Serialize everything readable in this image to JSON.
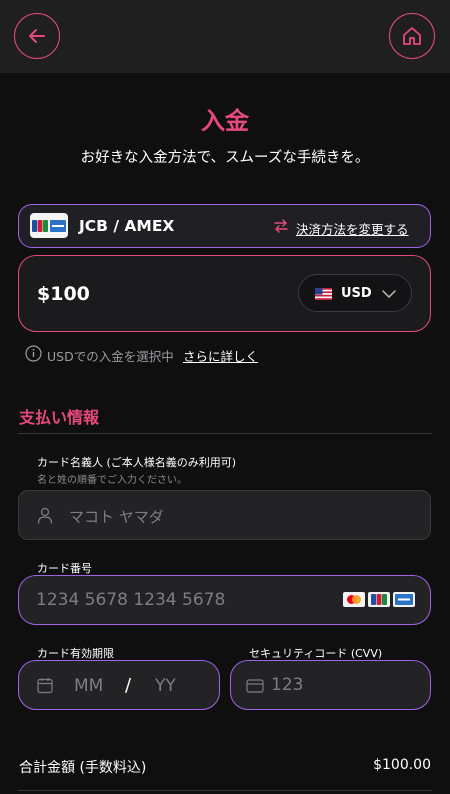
{
  "header": {
    "back_icon": "arrow-left-icon",
    "home_icon": "home-icon",
    "accent_color": "#e64a7b"
  },
  "page": {
    "title": "入金",
    "subtitle": "お好きな入金方法で、スムーズな手続きを。"
  },
  "payment_method": {
    "name": "JCB / AMEX",
    "logo_text_jcb": "JCB",
    "change_label": "決済方法を変更する",
    "border_color": "#9f63e6"
  },
  "amount": {
    "value": "$100",
    "currency": "USD"
  },
  "info": {
    "text": "USDでの入金を選択中",
    "link": "さらに詳しく"
  },
  "section": {
    "title": "支払い情報"
  },
  "form": {
    "cardholder": {
      "label": "カード名義人 (ご本人様名義のみ利用可)",
      "hint": "名と姓の順番でご入力ください。",
      "placeholder": "マコト ヤマダ"
    },
    "card_number": {
      "label": "カード番号",
      "placeholder": "1234 5678 1234 5678",
      "brands": [
        "mastercard",
        "jcb",
        "amex"
      ]
    },
    "expiry": {
      "label": "カード有効期限",
      "month_placeholder": "MM",
      "separator": "/",
      "year_placeholder": "YY"
    },
    "cvv": {
      "label": "セキュリティコード (CVV)",
      "placeholder": "123"
    }
  },
  "summary": {
    "total_label": "合計金額 (手数料込)",
    "total_value": "$100.00"
  }
}
